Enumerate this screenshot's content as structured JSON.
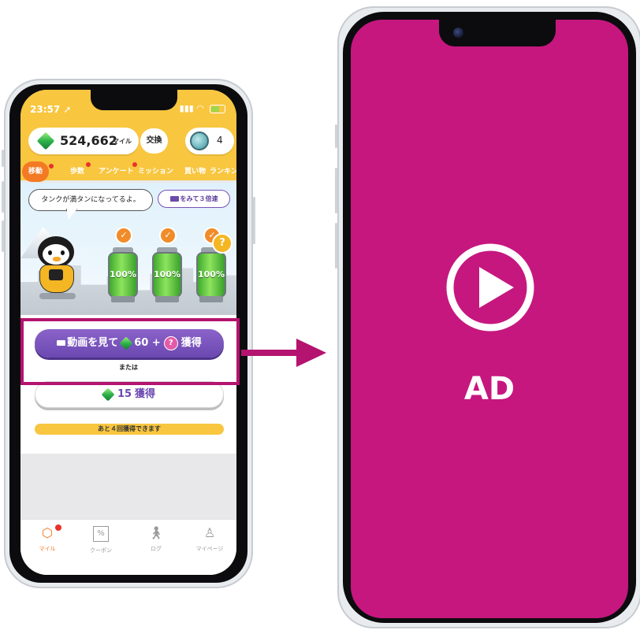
{
  "left_phone": {
    "status": {
      "time": "23:57"
    },
    "header": {
      "miles_value": "524,662",
      "miles_unit": "マイル",
      "exchange_label": "交換",
      "token_count": "4"
    },
    "tabs": [
      {
        "label": "移動",
        "active": true,
        "badge": true
      },
      {
        "label": "歩数",
        "badge": true
      },
      {
        "label": "アンケート",
        "badge": true
      },
      {
        "label": "ミッション"
      },
      {
        "label": "買い物"
      },
      {
        "label": "ランキン"
      }
    ],
    "scene": {
      "bubble_text": "タンクが満タンになってるよ。",
      "watch_3x_label": "をみて３倍速",
      "tanks": [
        "100%",
        "100%",
        "100%"
      ]
    },
    "watch_video": {
      "prefix": "動画を見て",
      "amount": "60",
      "plus": "+",
      "suffix": "獲得"
    },
    "or_label": "または",
    "earn_button": {
      "amount": "15",
      "suffix": "獲得"
    },
    "remaining_text": "あと４回獲得できます",
    "tabbar": [
      {
        "label": "マイル",
        "icon": "hexagon-icon",
        "active": true
      },
      {
        "label": "クーポン",
        "icon": "coupon-icon"
      },
      {
        "label": "ログ",
        "icon": "walker-icon"
      },
      {
        "label": "マイページ",
        "icon": "person-icon"
      }
    ]
  },
  "right_phone": {
    "ad_label": "AD",
    "icon": "play-circle-icon",
    "background_color": "#c6177f"
  },
  "colors": {
    "highlight": "#b4136f",
    "brand_yellow": "#f8c63f",
    "brand_orange": "#f37a22",
    "brand_purple": "#6b48b1"
  }
}
